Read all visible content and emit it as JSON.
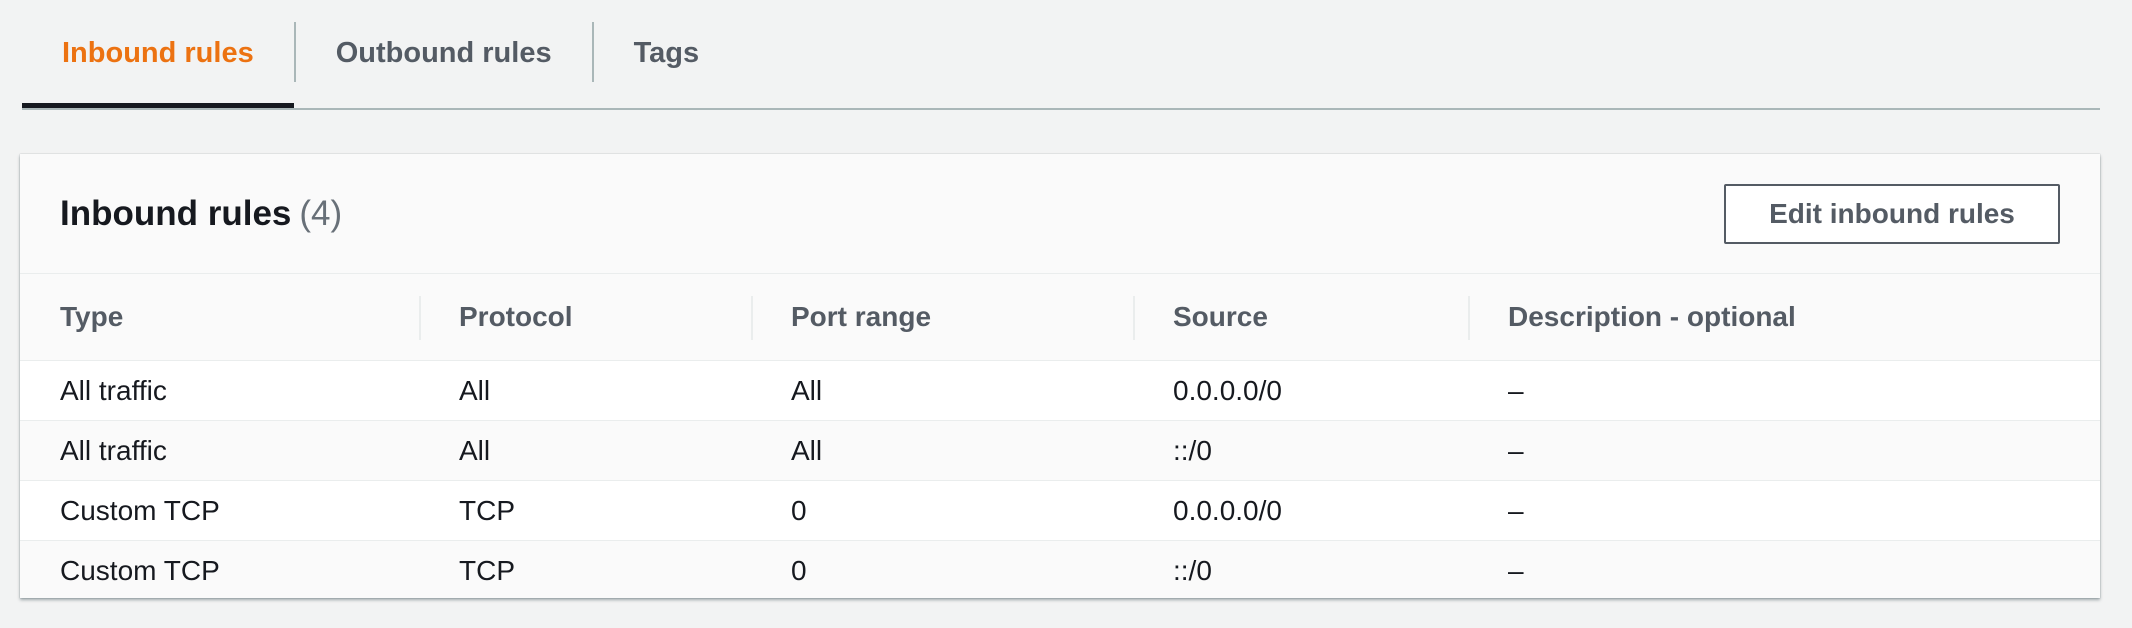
{
  "tabs": [
    {
      "label": "Inbound rules",
      "active": true
    },
    {
      "label": "Outbound rules",
      "active": false
    },
    {
      "label": "Tags",
      "active": false
    }
  ],
  "panel": {
    "title": "Inbound rules",
    "count": "(4)",
    "edit_button_label": "Edit inbound rules"
  },
  "table": {
    "columns": [
      "Type",
      "Protocol",
      "Port range",
      "Source",
      "Description - optional"
    ],
    "rows": [
      [
        "All traffic",
        "All",
        "All",
        "0.0.0.0/0",
        "–"
      ],
      [
        "All traffic",
        "All",
        "All",
        "::/0",
        "–"
      ],
      [
        "Custom TCP",
        "TCP",
        "0",
        "0.0.0.0/0",
        "–"
      ],
      [
        "Custom TCP",
        "TCP",
        "0",
        "::/0",
        "–"
      ]
    ]
  },
  "colors": {
    "active_tab": "#ec7211",
    "text": "#16191f",
    "muted": "#545b64",
    "background": "#f2f3f3"
  }
}
